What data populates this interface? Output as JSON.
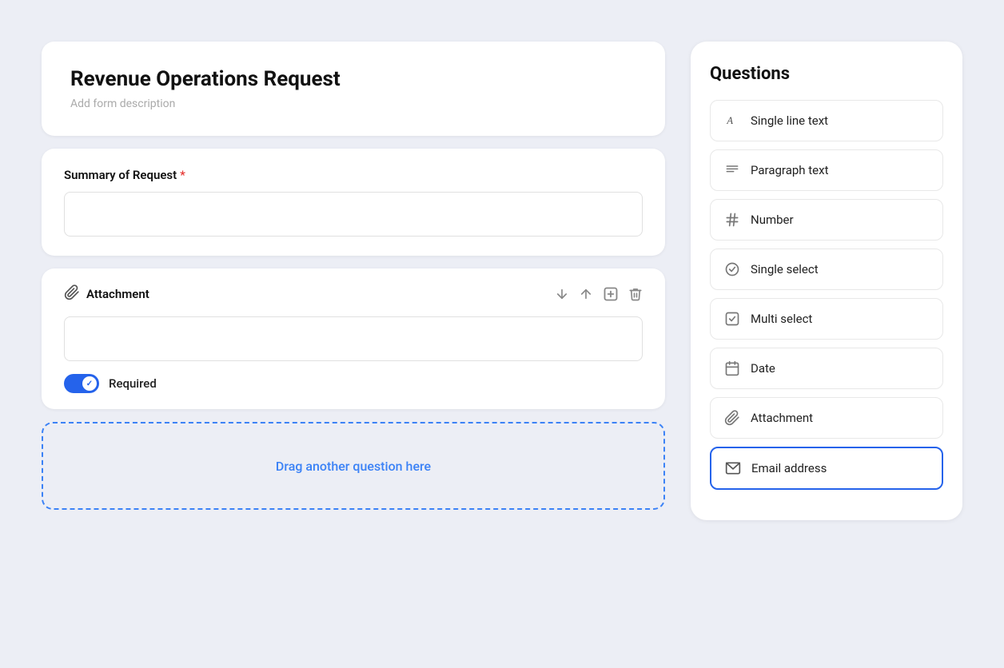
{
  "page": {
    "background": "#eceef5"
  },
  "form": {
    "title": "Revenue Operations Request",
    "description_placeholder": "Add form description",
    "fields": [
      {
        "id": "summary",
        "label": "Summary of Request",
        "required": true,
        "type": "text",
        "placeholder": ""
      },
      {
        "id": "attachment",
        "label": "Attachment",
        "type": "attachment",
        "placeholder": "",
        "required_toggle": true,
        "required_label": "Required"
      }
    ],
    "drop_zone_text": "Drag another question here"
  },
  "questions_panel": {
    "title": "Questions",
    "items": [
      {
        "id": "single-line-text",
        "label": "Single line text",
        "icon": "A"
      },
      {
        "id": "paragraph-text",
        "label": "Paragraph text",
        "icon": "paragraph"
      },
      {
        "id": "number",
        "label": "Number",
        "icon": "hash"
      },
      {
        "id": "single-select",
        "label": "Single select",
        "icon": "chevron-circle"
      },
      {
        "id": "multi-select",
        "label": "Multi select",
        "icon": "checkbox"
      },
      {
        "id": "date",
        "label": "Date",
        "icon": "calendar"
      },
      {
        "id": "attachment",
        "label": "Attachment",
        "icon": "paperclip"
      },
      {
        "id": "email-address",
        "label": "Email address",
        "icon": "email",
        "highlighted": true
      }
    ]
  },
  "actions": {
    "move_down": "↓",
    "move_up": "↑",
    "add": "+",
    "delete": "🗑"
  }
}
